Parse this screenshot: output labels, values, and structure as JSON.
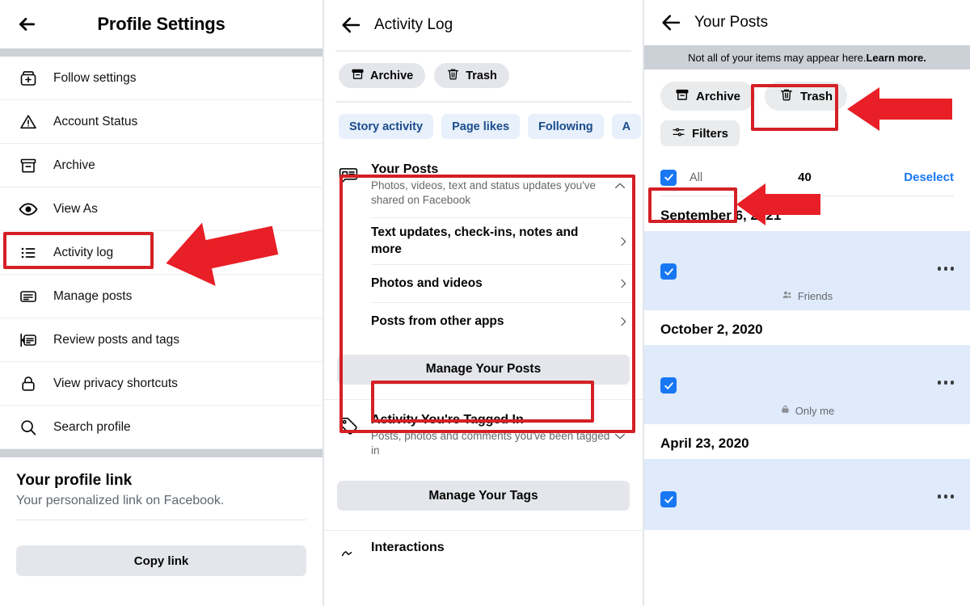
{
  "panels": {
    "left": {
      "header": {
        "title": "Profile Settings",
        "back_icon": "arrow-left-icon"
      },
      "items": [
        {
          "label": "Follow settings",
          "icon": "follow-settings-icon"
        },
        {
          "label": "Account Status",
          "icon": "warning-triangle-icon"
        },
        {
          "label": "Archive",
          "icon": "archive-box-icon"
        },
        {
          "label": "View As",
          "icon": "eye-icon"
        },
        {
          "label": "Activity log",
          "icon": "bullet-list-icon",
          "highlighted": true
        },
        {
          "label": "Manage posts",
          "icon": "post-card-icon"
        },
        {
          "label": "Review posts and tags",
          "icon": "review-posts-icon"
        },
        {
          "label": "View privacy shortcuts",
          "icon": "lock-icon"
        },
        {
          "label": "Search profile",
          "icon": "magnifier-icon"
        }
      ],
      "profile_link": {
        "title": "Your profile link",
        "subtitle": "Your personalized link on Facebook.",
        "button_label": "Copy link"
      }
    },
    "middle": {
      "header": {
        "title": "Activity Log",
        "back_icon": "arrow-left-icon"
      },
      "chips": [
        {
          "label": "Archive",
          "icon": "archive-box-icon"
        },
        {
          "label": "Trash",
          "icon": "trash-icon"
        }
      ],
      "tabs": [
        {
          "label": "Story activity"
        },
        {
          "label": "Page likes"
        },
        {
          "label": "Following"
        },
        {
          "label": "A"
        }
      ],
      "your_posts": {
        "icon": "post-bubble-icon",
        "title": "Your Posts",
        "description": "Photos, videos, text and status updates you've shared on Facebook",
        "caret": "chevron-up-icon",
        "sub_items": [
          "Text updates, check-ins, notes and more",
          "Photos and videos",
          "Posts from other apps"
        ],
        "manage_button": "Manage Your Posts"
      },
      "tagged_in": {
        "icon": "tag-icon",
        "title": "Activity You're Tagged In",
        "description": "Posts, photos and comments you've been tagged in",
        "caret": "chevron-down-icon",
        "manage_button": "Manage Your Tags"
      },
      "interactions": {
        "icon": "interactions-icon",
        "label": "Interactions"
      }
    },
    "right": {
      "header": {
        "title": "Your Posts",
        "back_icon": "arrow-left-icon"
      },
      "notice": {
        "text": "Not all of your items may appear here. ",
        "link": "Learn more."
      },
      "chips": [
        {
          "label": "Archive",
          "icon": "archive-box-icon"
        },
        {
          "label": "Trash",
          "icon": "trash-icon"
        }
      ],
      "filters": {
        "label": "Filters",
        "icon": "sliders-icon"
      },
      "selection": {
        "all_label": "All",
        "count": "40",
        "deselect_label": "Deselect",
        "checked": true
      },
      "groups": [
        {
          "date": "September 6, 2021",
          "audience": "Friends",
          "audience_icon": "friends-icon",
          "checked": true,
          "menu_icon": "ellipsis-icon"
        },
        {
          "date": "October 2, 2020",
          "audience": "Only me",
          "audience_icon": "lock-icon",
          "checked": true,
          "menu_icon": "ellipsis-icon"
        },
        {
          "date": "April 23, 2020",
          "audience": "",
          "audience_icon": "lock-icon",
          "checked": true,
          "menu_icon": "ellipsis-icon"
        }
      ]
    }
  },
  "annotations": {
    "accent_red": "#d42026",
    "highlight_boxes": [
      {
        "name": "activity-log-highlight"
      },
      {
        "name": "your-posts-section-highlight"
      },
      {
        "name": "manage-your-posts-highlight"
      },
      {
        "name": "trash-chip-highlight"
      },
      {
        "name": "select-all-highlight"
      }
    ],
    "arrows": [
      {
        "name": "arrow-to-activity-log"
      },
      {
        "name": "arrow-to-trash"
      },
      {
        "name": "arrow-to-select-all"
      }
    ]
  }
}
